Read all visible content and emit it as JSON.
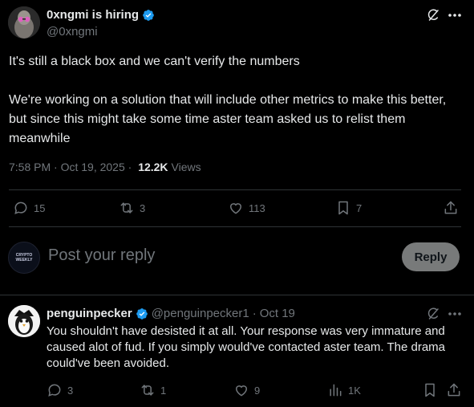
{
  "tweet": {
    "author_name": "0xngmi is hiring",
    "author_handle": "@0xngmi",
    "paragraphs": [
      "It's still a black box and we can't verify the numbers",
      "We're working on a solution that will include other metrics to make this better, but since this might take some time aster team asked us to relist them meanwhile"
    ],
    "timestamp": "7:58 PM · Oct 19, 2025 · ",
    "views_count": "12.2K",
    "views_label": "Views",
    "stats": {
      "replies": "15",
      "reposts": "3",
      "likes": "113",
      "bookmarks": "7"
    }
  },
  "composer": {
    "avatar_text": "CRYPTO WEEKLY",
    "placeholder": "Post your reply",
    "reply_button": "Reply"
  },
  "reply": {
    "author_name": "penguinpecker",
    "author_handle": "@penguinpecker1",
    "separator": "·",
    "date": "Oct 19",
    "text": "You shouldn't have desisted it at all. Your response was very immature and caused alot of fud. If you simply would've contacted aster team. The drama could've been avoided.",
    "stats": {
      "replies": "3",
      "reposts": "1",
      "likes": "9",
      "views": "1K"
    }
  },
  "colors": {
    "background": "#000000",
    "text": "#e7e9ea",
    "muted": "#71767b",
    "verified": "#1d9bf0",
    "divider": "#2f3336",
    "reply_button_bg": "#787a7a"
  },
  "icons": [
    "verified-badge-icon",
    "grok-icon",
    "more-icon",
    "reply-icon",
    "repost-icon",
    "like-icon",
    "bookmark-icon",
    "share-icon",
    "views-icon"
  ]
}
